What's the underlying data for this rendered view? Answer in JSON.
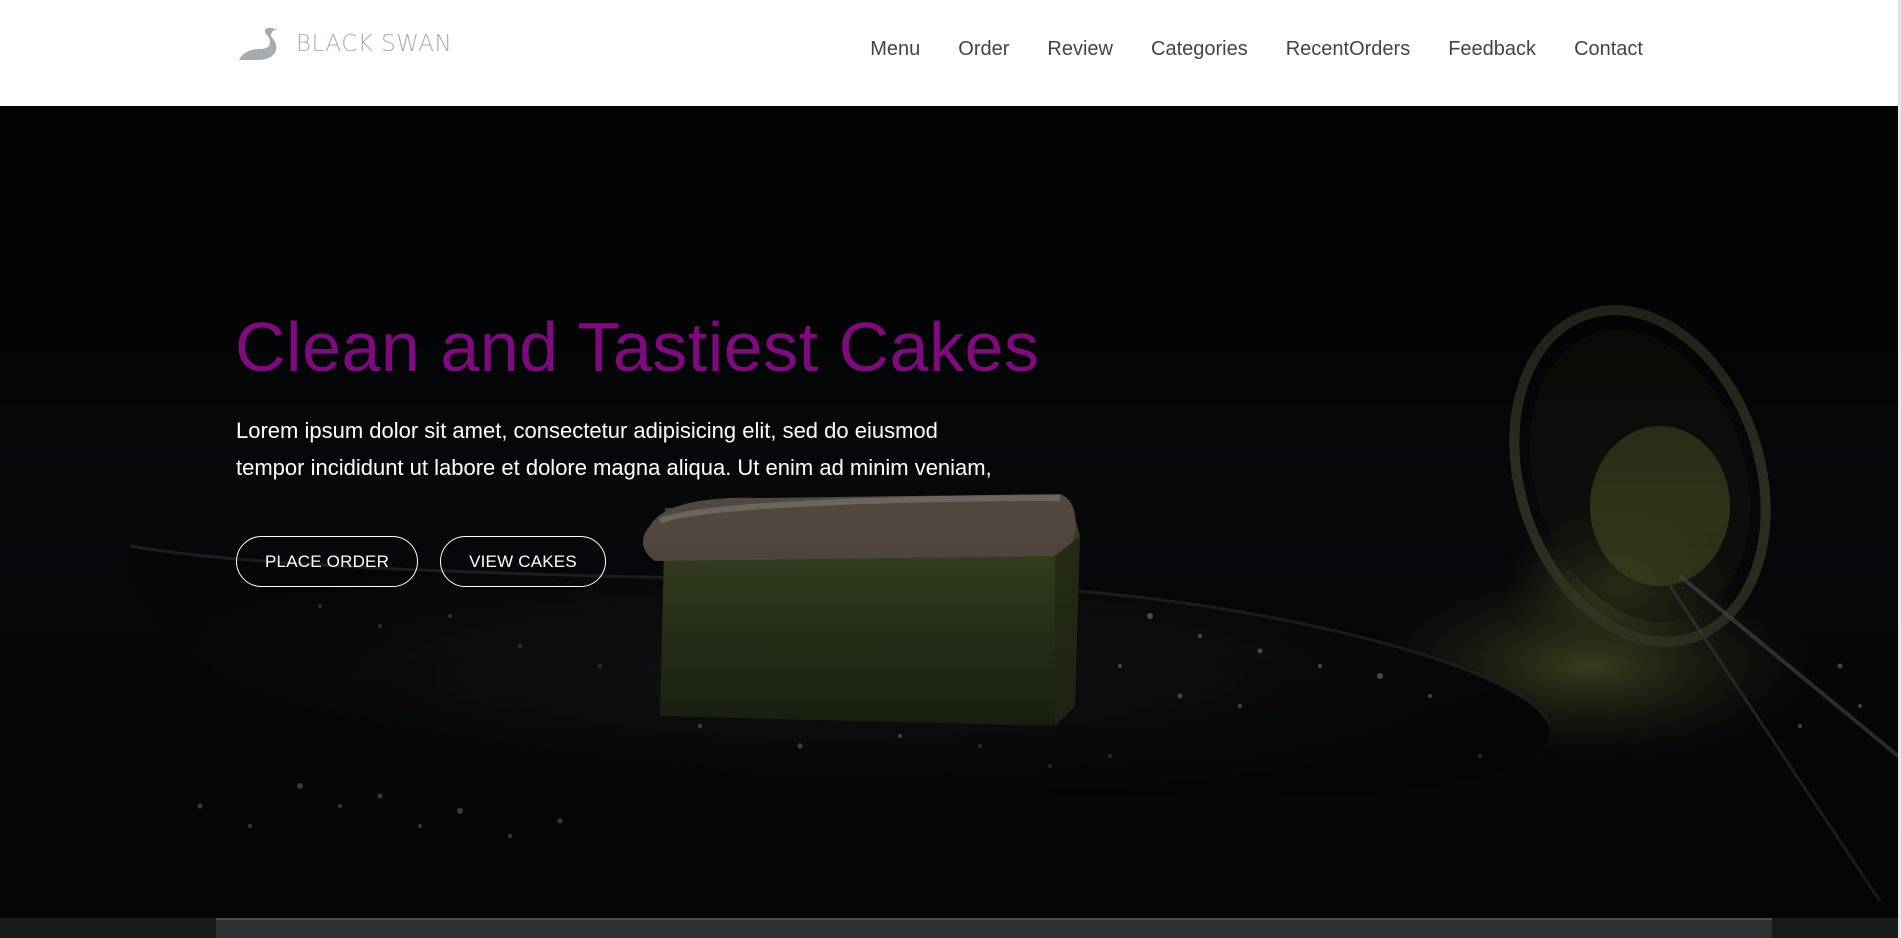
{
  "brand": {
    "name": "BLACK SWAN",
    "logo_icon": "swan-icon",
    "logo_color": "#a6abb2"
  },
  "nav": {
    "items": [
      {
        "label": "Menu"
      },
      {
        "label": "Order"
      },
      {
        "label": "Review"
      },
      {
        "label": "Categories"
      },
      {
        "label": "RecentOrders"
      },
      {
        "label": "Feedback"
      },
      {
        "label": "Contact"
      }
    ]
  },
  "hero": {
    "title": "Clean and Tastiest Cakes",
    "title_color": "#7e0a7e",
    "text_line1": "Lorem ipsum dolor sit amet, consectetur adipisicing elit, sed do eiusmod",
    "text_line2": "tempor incididunt ut labore et dolore magna aliqua. Ut enim ad minim veniam,",
    "buttons": [
      {
        "label": "PLACE ORDER"
      },
      {
        "label": "VIEW CAKES"
      }
    ],
    "background_image": "matcha-cake-on-dark-plate"
  },
  "colors": {
    "header_bg": "#ffffff",
    "nav_text": "#444448",
    "hero_bg": "#08090c",
    "hero_text": "#ffffff"
  }
}
